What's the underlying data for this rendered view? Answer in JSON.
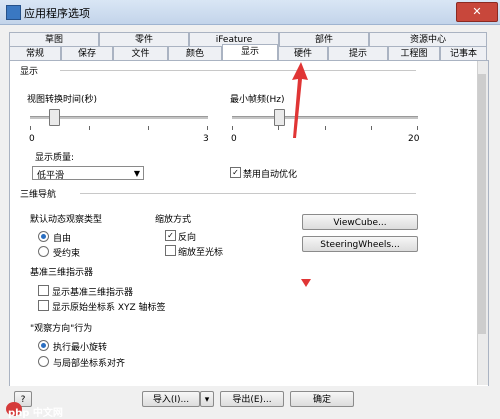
{
  "window": {
    "title": "应用程序选项",
    "close_label": "✕"
  },
  "tabs_back": [
    "草图",
    "零件",
    "iFeature",
    "部件",
    "资源中心"
  ],
  "tabs_front": [
    "常规",
    "保存",
    "文件",
    "颜色",
    "显示",
    "硬件",
    "提示",
    "工程图",
    "记事本"
  ],
  "active_tab": "显示",
  "display": {
    "section": "显示",
    "transition_label": "视图转换时间(秒)",
    "transition_min": "0",
    "transition_max": "3",
    "framerate_label": "最小帧频(Hz)",
    "framerate_min": "0",
    "framerate_max": "20",
    "quality_label": "显示质量:",
    "quality_value": "低平滑",
    "disable_auto_refine_label": "禁用自动优化",
    "disable_auto_refine_checked": "✓",
    "transition_value": 0.4,
    "framerate_value": 5
  },
  "nav3d": {
    "section": "三维导航",
    "default_orbit_label": "默认动态观察类型",
    "orbit_free": "自由",
    "orbit_constrained": "受约束",
    "zoom_label": "缩放方式",
    "zoom_reverse": "反向",
    "zoom_reverse_checked": "✓",
    "zoom_to_cursor": "缩放至光标",
    "viewcube_button": "ViewCube...",
    "steering_button": "SteeringWheels..."
  },
  "indicator": {
    "section": "基准三维指示器",
    "show_indicator": "显示基准三维指示器",
    "show_xyz_labels": "显示原始坐标系 XYZ 轴标签"
  },
  "viewdir": {
    "section": "\"观察方向\"行为",
    "option_min_rotate": "执行最小旋转",
    "option_align_local": "与局部坐标系对齐"
  },
  "footer": {
    "help": "?",
    "import": "导入(I)...",
    "export": "导出(E)...",
    "ok": "确定"
  },
  "watermark": "php 中文网"
}
